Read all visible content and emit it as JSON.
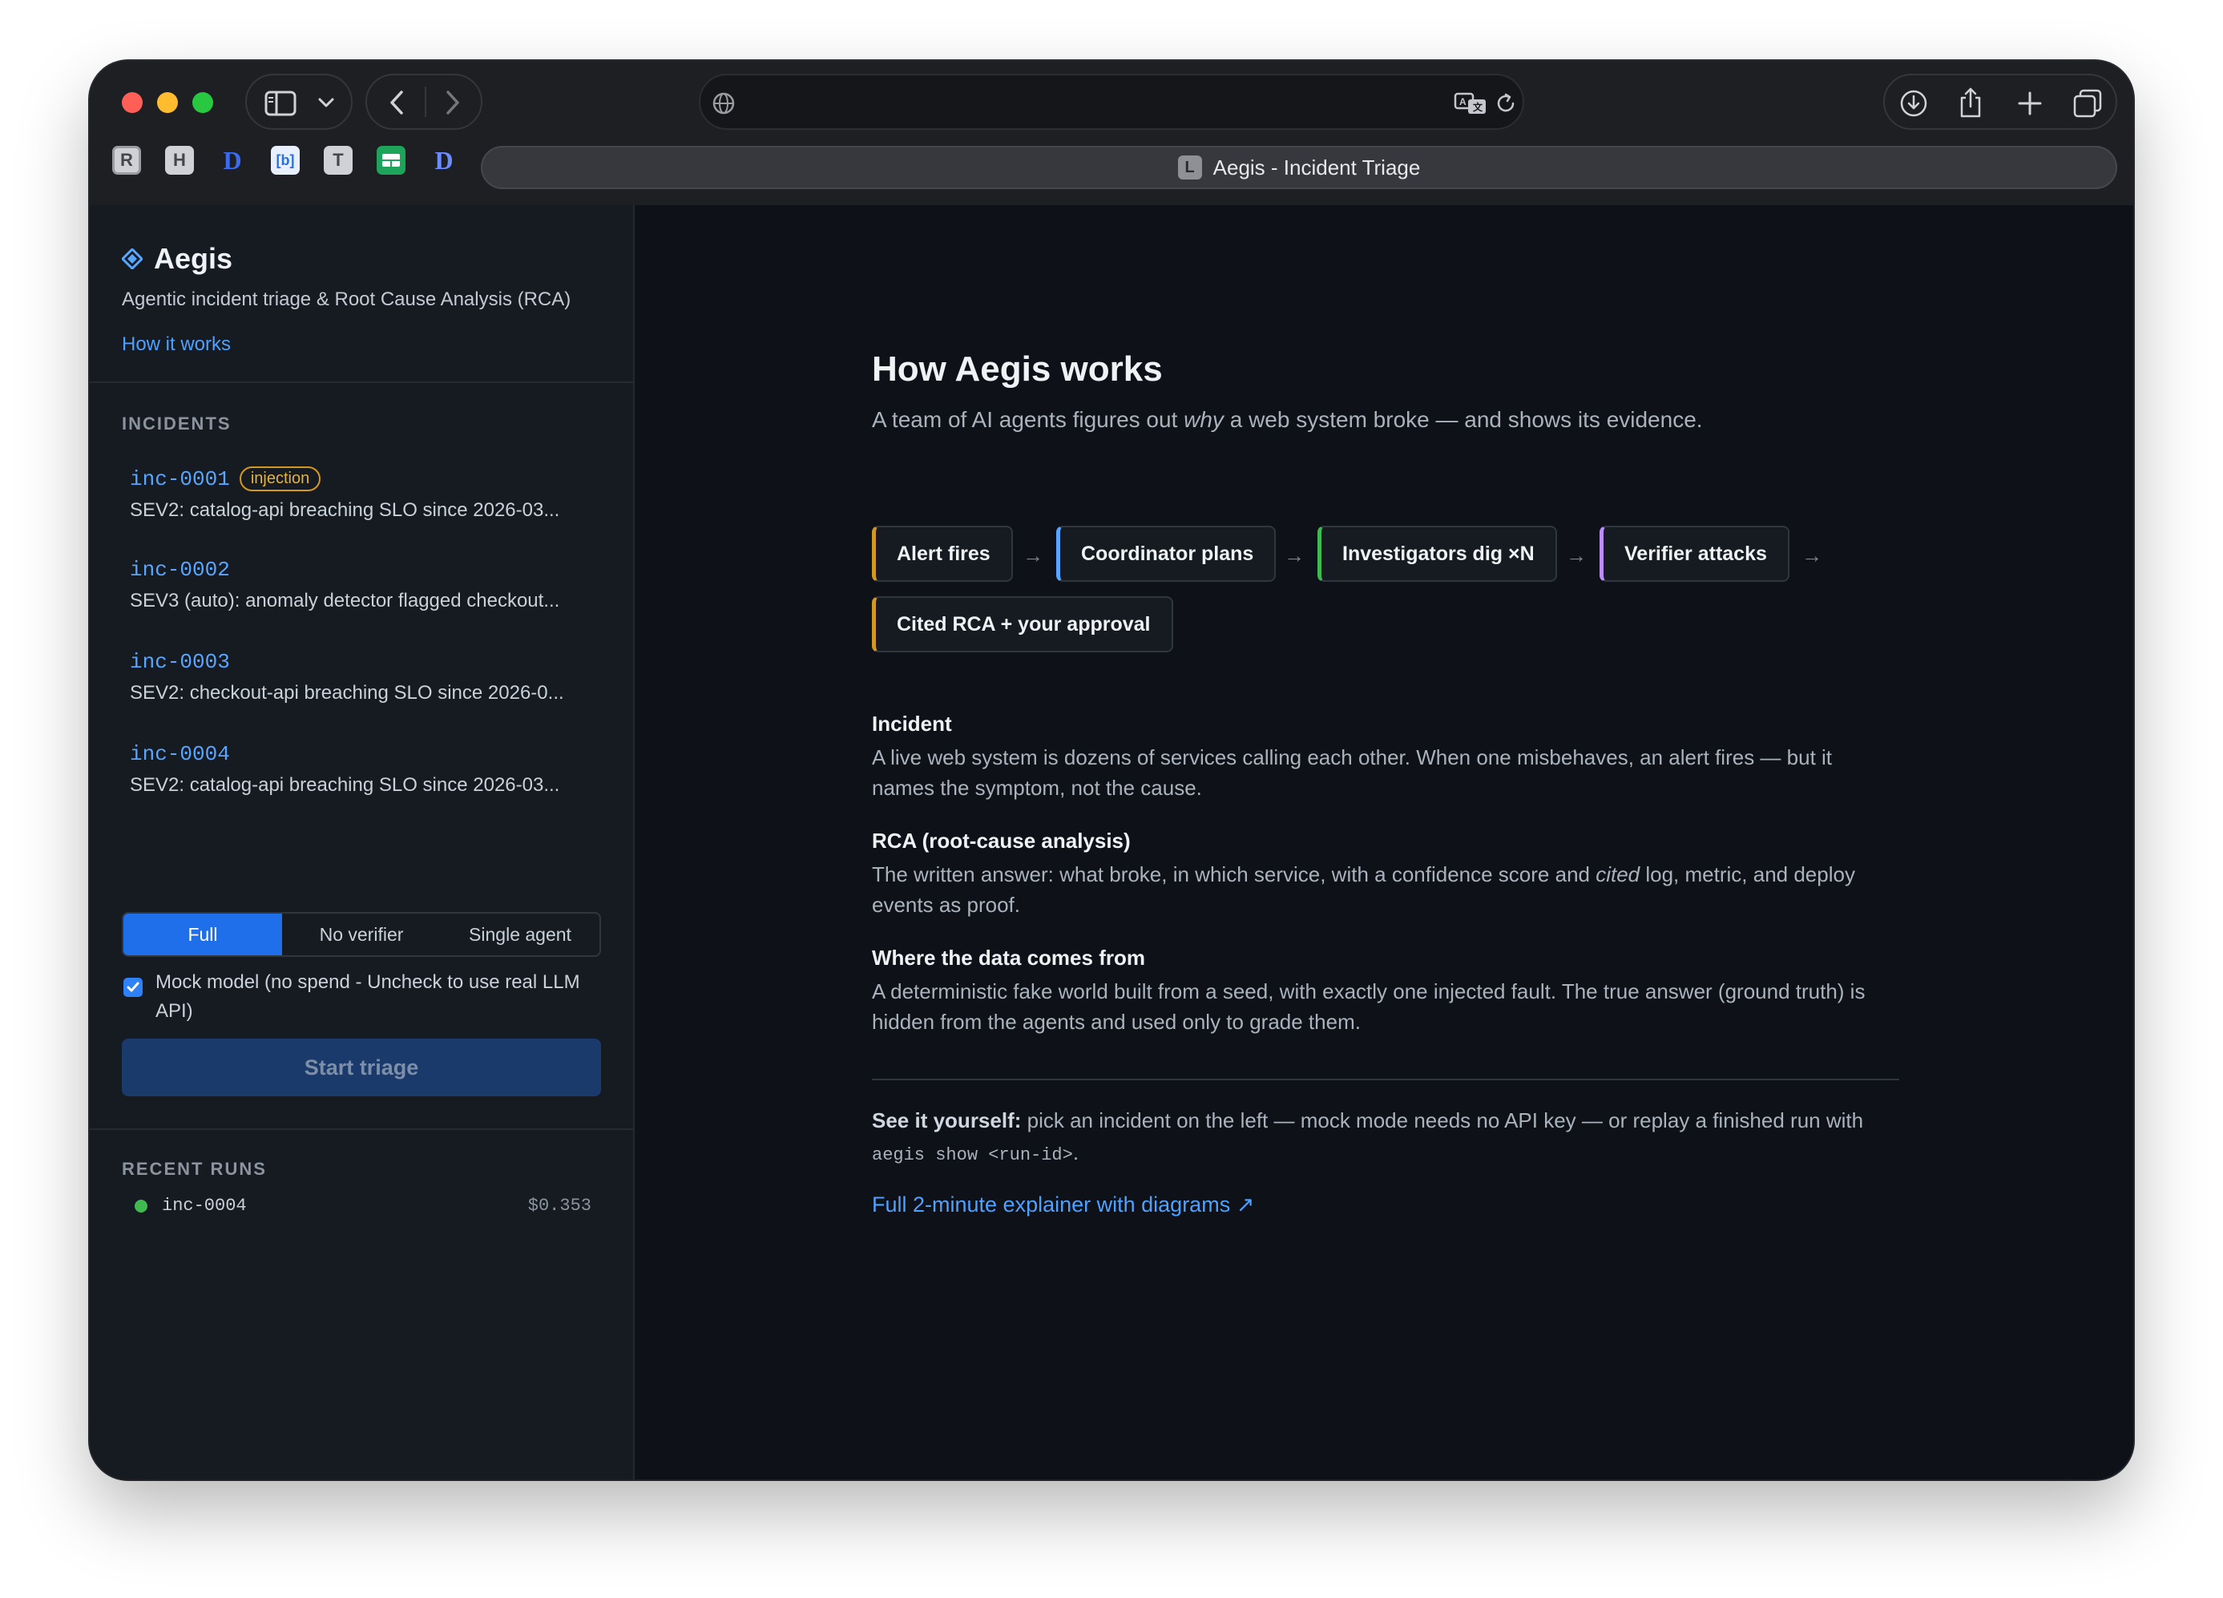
{
  "browser": {
    "tab_title": "Aegis - Incident Triage",
    "tab_favicon_letter": "L",
    "toolbar_favicons": [
      "R",
      "H",
      "D",
      "[b]",
      "T",
      "D"
    ]
  },
  "sidebar": {
    "brand": "Aegis",
    "tagline": "Agentic incident triage & Root Cause Analysis (RCA)",
    "how_link": "How it works",
    "incidents_label": "INCIDENTS",
    "incidents": [
      {
        "id": "inc-0001",
        "badge": "injection",
        "title": "SEV2: catalog-api breaching SLO since 2026-03..."
      },
      {
        "id": "inc-0002",
        "title": "SEV3 (auto): anomaly detector flagged checkout..."
      },
      {
        "id": "inc-0003",
        "title": "SEV2: checkout-api breaching SLO since 2026-0..."
      },
      {
        "id": "inc-0004",
        "title": "SEV2: catalog-api breaching SLO since 2026-03..."
      }
    ],
    "modes": [
      "Full",
      "No verifier",
      "Single agent"
    ],
    "selected_mode": "Full",
    "mock_label": "Mock model (no spend - Uncheck to use real LLM API)",
    "mock_checked": true,
    "start_button": "Start triage",
    "recent_label": "RECENT RUNS",
    "recent_runs": [
      {
        "id": "inc-0004",
        "cost": "$0.353",
        "status_color": "#3fb950"
      }
    ]
  },
  "main": {
    "title": "How Aegis works",
    "subtitle_before": "A team of AI agents figures out ",
    "subtitle_em": "why",
    "subtitle_after": " a web system broke — and shows its evidence.",
    "pipeline": [
      {
        "label": "Alert fires",
        "color": "#d29922"
      },
      {
        "label": "Coordinator plans",
        "color": "#58a6ff"
      },
      {
        "label": "Investigators dig ×N",
        "color": "#3fb950"
      },
      {
        "label": "Verifier attacks",
        "color": "#bc8cff"
      },
      {
        "label": "Cited RCA + your approval",
        "color": "#d29922"
      }
    ],
    "arrow": "→",
    "sections": [
      {
        "heading": "Incident",
        "body": "A live web system is dozens of services calling each other. When one misbehaves, an alert fires — but it names the symptom, not the cause."
      },
      {
        "heading": "RCA (root-cause analysis)",
        "body_before": "The written answer: what broke, in which service, with a confidence score and ",
        "body_em": "cited",
        "body_after": " log, metric, and deploy events as proof."
      },
      {
        "heading": "Where the data comes from",
        "body": "A deterministic fake world built from a seed, with exactly one injected fault. The true answer (ground truth) is hidden from the agents and used only to grade them."
      }
    ],
    "see_bold": "See it yourself:",
    "see_text": " pick an incident on the left — mock mode needs no API key — or replay a finished run with ",
    "see_code": "aegis show <run-id>",
    "see_end": ".",
    "explainer_link": "Full 2-minute explainer with diagrams ↗"
  }
}
